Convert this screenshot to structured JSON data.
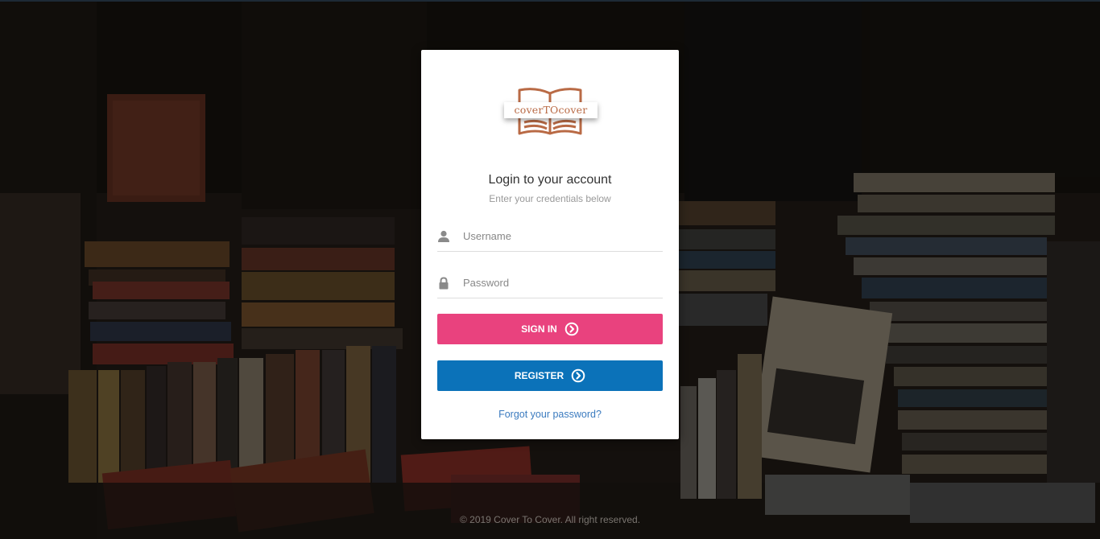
{
  "brand": {
    "logo_text": "coverTOcover",
    "logo_color": "#b96a45"
  },
  "login": {
    "title": "Login to your account",
    "subtitle": "Enter your credentials below",
    "username_placeholder": "Username",
    "password_placeholder": "Password",
    "signin_label": "SIGN IN",
    "register_label": "REGISTER",
    "forgot_label": "Forgot your password?",
    "icons": {
      "username": "user-icon",
      "password": "lock-icon",
      "buttons": "chevron-circle-right-icon"
    }
  },
  "colors": {
    "signin": "#e9427e",
    "register": "#0b72b9",
    "link": "#3b7bbf"
  },
  "footer": {
    "copyright": "© 2019 Cover To Cover. All right reserved."
  }
}
